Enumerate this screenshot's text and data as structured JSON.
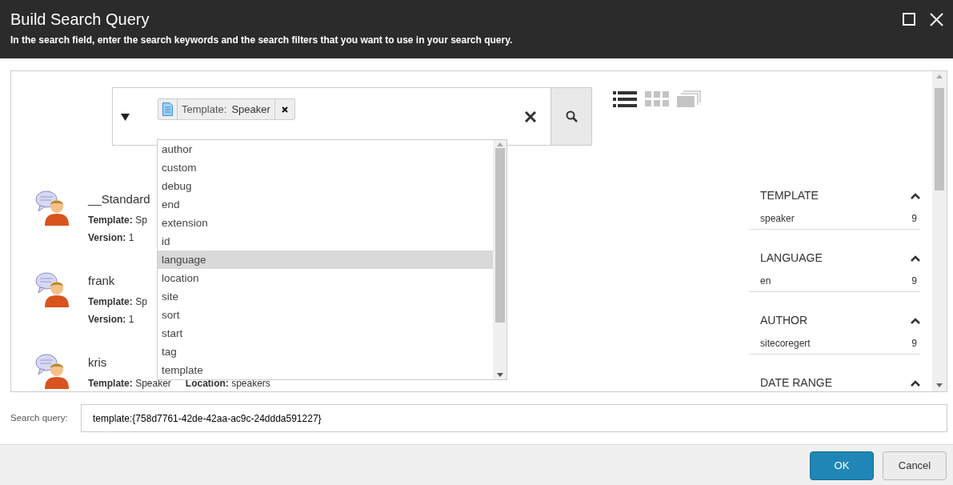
{
  "window": {
    "title": "Build Search Query",
    "subtitle": "In the search field, enter the search keywords and the search filters that you want to use in your search query."
  },
  "search": {
    "filter_tag": {
      "label": "Template:",
      "value": "Speaker"
    }
  },
  "view_modes": [
    {
      "kind": "list",
      "selected": true
    },
    {
      "kind": "grid",
      "selected": false
    },
    {
      "kind": "stack",
      "selected": false
    }
  ],
  "dropdown": {
    "items": [
      {
        "label": "author",
        "selected": false
      },
      {
        "label": "custom",
        "selected": false
      },
      {
        "label": "debug",
        "selected": false
      },
      {
        "label": "end",
        "selected": false
      },
      {
        "label": "extension",
        "selected": false
      },
      {
        "label": "id",
        "selected": false
      },
      {
        "label": "language",
        "selected": true
      },
      {
        "label": "location",
        "selected": false
      },
      {
        "label": "site",
        "selected": false
      },
      {
        "label": "sort",
        "selected": false
      },
      {
        "label": "start",
        "selected": false
      },
      {
        "label": "tag",
        "selected": false
      },
      {
        "label": "template",
        "selected": false
      }
    ]
  },
  "results": [
    {
      "name": "__Standard",
      "fields": [
        [
          {
            "label": "Template:",
            "value": "Sp"
          }
        ],
        [
          {
            "label": "Version:",
            "value": "1"
          }
        ]
      ]
    },
    {
      "name": "frank",
      "fields": [
        [
          {
            "label": "Template:",
            "value": "Sp"
          }
        ],
        [
          {
            "label": "Version:",
            "value": "1"
          }
        ]
      ]
    },
    {
      "name": "kris",
      "fields": [
        [
          {
            "label": "Template:",
            "value": "Speaker"
          },
          {
            "label": "Location:",
            "value": "speakers"
          }
        ]
      ]
    }
  ],
  "facets": [
    {
      "title": "TEMPLATE",
      "expanded": true,
      "items": [
        {
          "label": "speaker",
          "count": "9"
        }
      ]
    },
    {
      "title": "LANGUAGE",
      "expanded": true,
      "items": [
        {
          "label": "en",
          "count": "9"
        }
      ]
    },
    {
      "title": "AUTHOR",
      "expanded": true,
      "items": [
        {
          "label": "sitecoregert",
          "count": "9"
        }
      ]
    },
    {
      "title": "DATE RANGE",
      "expanded": true
    }
  ],
  "query": {
    "label": "Search query:",
    "value": "template:{758d7761-42de-42aa-ac9c-24ddda591227}"
  },
  "buttons": [
    {
      "label": "OK",
      "kind": "primary"
    },
    {
      "label": "Cancel",
      "kind": "secondary"
    }
  ]
}
